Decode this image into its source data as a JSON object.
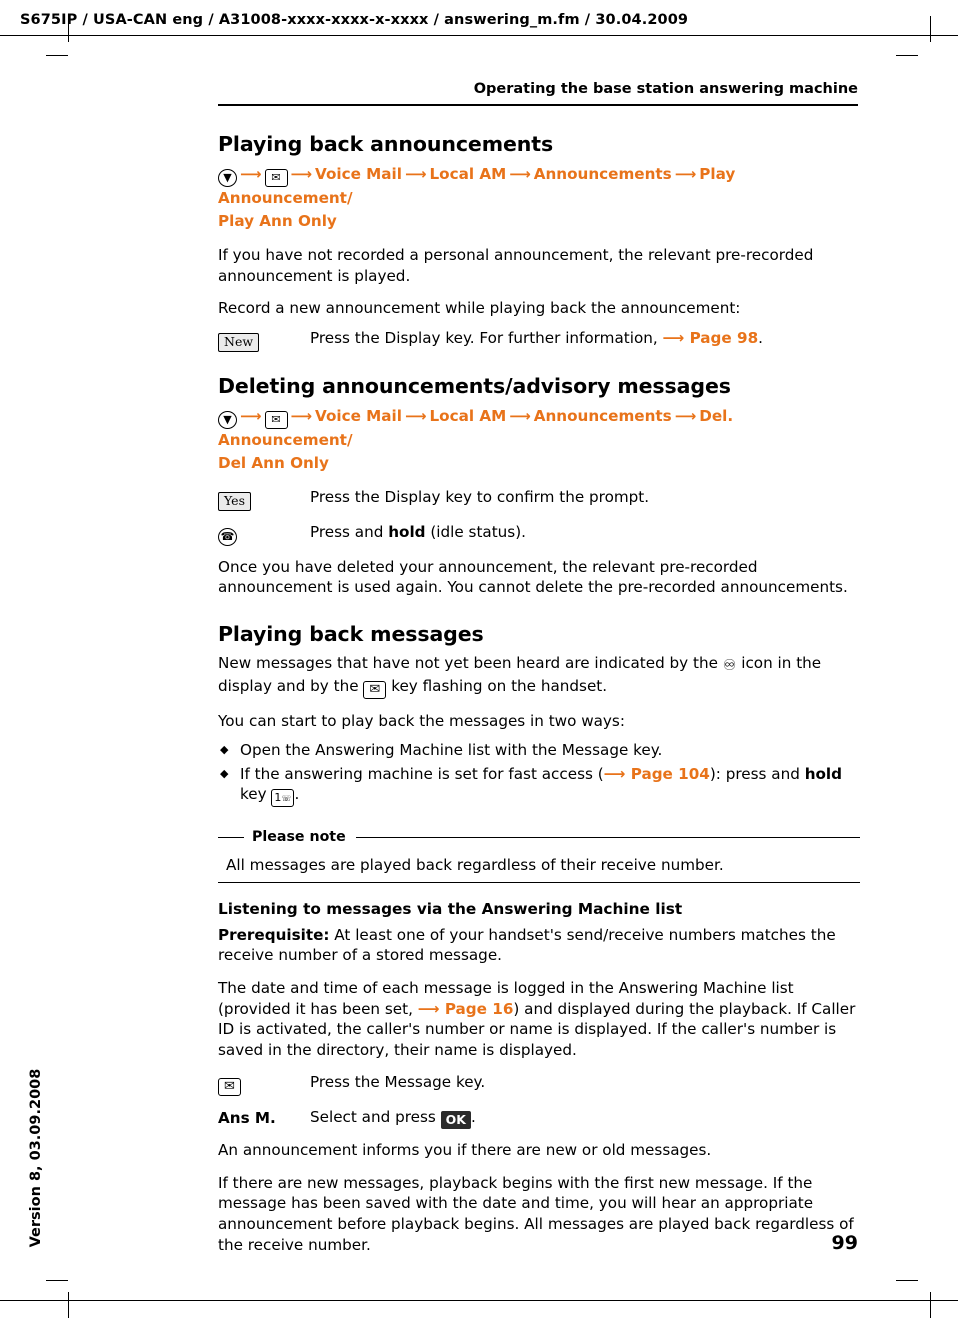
{
  "header": {
    "file_line": "S675IP  / USA-CAN eng / A31008-xxxx-xxxx-x-xxxx / answering_m.fm / 30.04.2009",
    "running_head": "Operating the base station answering machine",
    "side_text": "Version 8, 03.09.2008",
    "page_number": "99"
  },
  "sections": [
    {
      "id": "playing-back-announcements",
      "heading": "Playing back announcements",
      "menu_path": {
        "items": [
          "Voice Mail",
          "Local AM",
          "Announcements",
          "Play Announcement/"
        ],
        "second_line": "Play Ann Only"
      },
      "paragraphs": [
        "If you have not recorded a personal announcement, the relevant pre-recorded announcement is played.",
        "Record a new announcement while playing back the announcement:"
      ],
      "rows": [
        {
          "key_label": "New",
          "key_type": "display",
          "text_before": "Press the Display key. For further information, ",
          "link": "Page 98",
          "text_after": "."
        }
      ]
    },
    {
      "id": "deleting-announcements",
      "heading": "Deleting announcements/advisory messages",
      "menu_path": {
        "items": [
          "Voice Mail",
          "Local AM",
          "Announcements",
          "Del. Announcement/"
        ],
        "second_line": "Del Ann Only"
      },
      "rows": [
        {
          "key_label": "Yes",
          "key_type": "display",
          "text": "Press the Display key to confirm the prompt."
        },
        {
          "key_label": "end-call-key",
          "key_type": "round",
          "text_before": "Press and ",
          "bold": "hold",
          "text_after": " (idle status)."
        }
      ],
      "paragraphs": [
        "Once you have deleted your announcement, the relevant pre-recorded announcement is used again. You cannot delete the pre-recorded announcements."
      ]
    },
    {
      "id": "playing-back-messages",
      "heading": "Playing back messages",
      "intro_part1": "New messages that have not yet been heard are indicated by the ",
      "intro_part2": " icon in the display and by the ",
      "intro_part3": " key flashing on the handset.",
      "two_ways": "You can start to play back the messages in two ways:",
      "bullets": [
        {
          "text": "Open the Answering Machine list with the Message key."
        },
        {
          "text_before": "If the answering machine is set for fast access (",
          "link": "Page 104",
          "text_mid": "): press and ",
          "bold": "hold",
          "text_after": " key ",
          "text_end": "."
        }
      ],
      "note": {
        "title": "Please note",
        "body": "All messages are played back regardless of their receive number."
      },
      "subheading": "Listening to messages via the Answering Machine list",
      "prereq_bold": "Prerequisite:",
      "prereq_text": " At least one of your handset's send/receive numbers matches the receive number of a stored message.",
      "para_datetime_1": "The date and time of each message is logged in the Answering Machine list (provided it has been set, ",
      "para_datetime_link": "Page 16",
      "para_datetime_2": ") and displayed during the playback. If Caller ID is activated, the caller's number or name is displayed. If the caller's number is saved in the directory, their name is displayed.",
      "rows": [
        {
          "key_label": "message-key",
          "key_type": "glyph",
          "text": "Press the Message key."
        },
        {
          "key_label": "Ans M.",
          "key_type": "bold-text",
          "text_before": "Select and press ",
          "button": "OK",
          "text_after": "."
        }
      ],
      "para_announcement": "An announcement informs you if there are new or old messages.",
      "para_final": "If there are new messages, playback begins with the first new message. If the message has been saved with the date and time, you will hear an appropriate announcement before playback begins. All messages are played back regardless of the receive number."
    }
  ],
  "colors": {
    "accent_orange": "#e8731a",
    "text": "#000000",
    "key_fill": "#ebebeb",
    "ok_fill": "#2b2b2b"
  }
}
